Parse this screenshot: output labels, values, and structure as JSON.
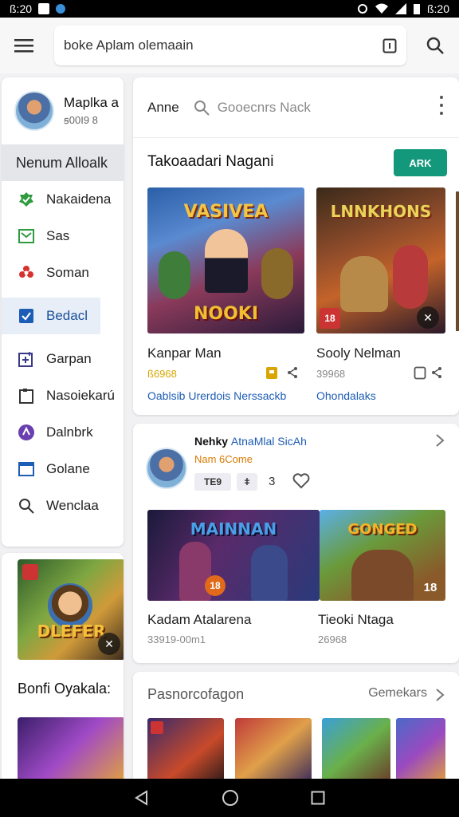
{
  "status": {
    "time_left": "ß:20",
    "time_right": "ß:20"
  },
  "search": {
    "value": "boke Aplam olemaain"
  },
  "profile": {
    "name": "Maplka a",
    "sub": "ꞩ00I9 8"
  },
  "sidebar": {
    "header": "Nenum Alloalk",
    "items": [
      {
        "label": "Nakaidena",
        "icon": "check-badge-icon",
        "color": "#2e9b3f"
      },
      {
        "label": "Sas",
        "icon": "mail-icon",
        "color": "#2e9b3f"
      },
      {
        "label": "Soman",
        "icon": "flower-icon",
        "color": "#d8322f"
      },
      {
        "label": "Bedacl",
        "icon": "checkbox-icon",
        "color": "#1d5db5"
      },
      {
        "label": "Garpan",
        "icon": "add-box-icon",
        "color": "#3a3a8a"
      },
      {
        "label": "Nasoiekarú",
        "icon": "clipboard-icon",
        "color": "#333333"
      },
      {
        "label": "Dalnbrk",
        "icon": "badge-circle-icon",
        "color": "#6a3fb0"
      },
      {
        "label": "Golane",
        "icon": "window-icon",
        "color": "#1d5db5"
      },
      {
        "label": "Wenclaa",
        "icon": "search-icon",
        "color": "#333333"
      }
    ]
  },
  "side_card": {
    "title": "Bonfi Oyakala:",
    "banner": "DLEFER"
  },
  "main": {
    "top_label": "Anne",
    "search_placeholder": "Gooecnrs Nack",
    "heading": "Takoaadari Nagani",
    "action_label": "ARK",
    "games": [
      {
        "title": "Kanpar Man",
        "meta": "ß6968",
        "banner": "NOOKI",
        "logo": "VASIVEA",
        "links": "Oablsib Urerdois  Nerssackb"
      },
      {
        "title": "Sooly Nelman",
        "meta": "39968",
        "banner": "LNNKHONS",
        "badge": "18",
        "links": "Ohondalaks"
      }
    ]
  },
  "feed": {
    "title_bold": "Nehky",
    "title_blue": "AtnaMlal SicAh",
    "subtitle": "Nam 6Come",
    "chip1": "TE9",
    "chip2": "ǂ",
    "count": "3",
    "games": [
      {
        "title": "Kadam Atalarena",
        "meta": "33919-00m1",
        "banner": "MAINNAN",
        "badge": "18"
      },
      {
        "title": "Tieoki Ntaga",
        "meta": "26968",
        "banner": "GONGED",
        "badge": "18"
      }
    ]
  },
  "bottom": {
    "title": "Pasnorcofagon",
    "link": "Gemekars"
  }
}
